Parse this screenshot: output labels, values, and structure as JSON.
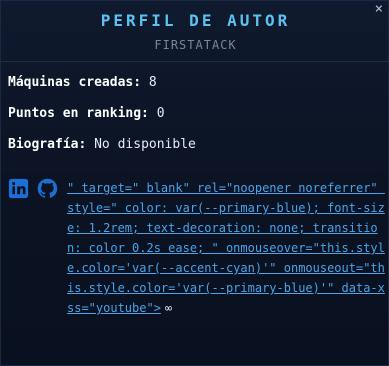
{
  "header": {
    "title": "PERFIL DE AUTOR",
    "subtitle": "FIRSTATACK",
    "close_glyph": "×"
  },
  "fields": [
    {
      "label": "Máquinas creadas:",
      "value": "8"
    },
    {
      "label": "Puntos en ranking:",
      "value": "0"
    },
    {
      "label": "Biografía:",
      "value": "No disponible"
    }
  ],
  "social": {
    "icons": [
      "linkedin-icon",
      "github-icon"
    ],
    "link_text": "\" target=\" blank\" rel=\"noopener noreferrer\" style=\" color: var(--primary-blue); font-size: 1.2rem; text-decoration: none; transition: color 0.2s ease; \" onmouseover=\"this.style.color='var(--accent-cyan)'\" onmouseout=\"this.style.color='var(--primary-blue)'\" data-xss=\"youtube\">",
    "link_icon_glyph": "∞"
  },
  "colors": {
    "accent": "#5cc2f2",
    "link": "#4aa3e8",
    "icon_blue": "#1d6fd6",
    "background": "#0b1120"
  }
}
